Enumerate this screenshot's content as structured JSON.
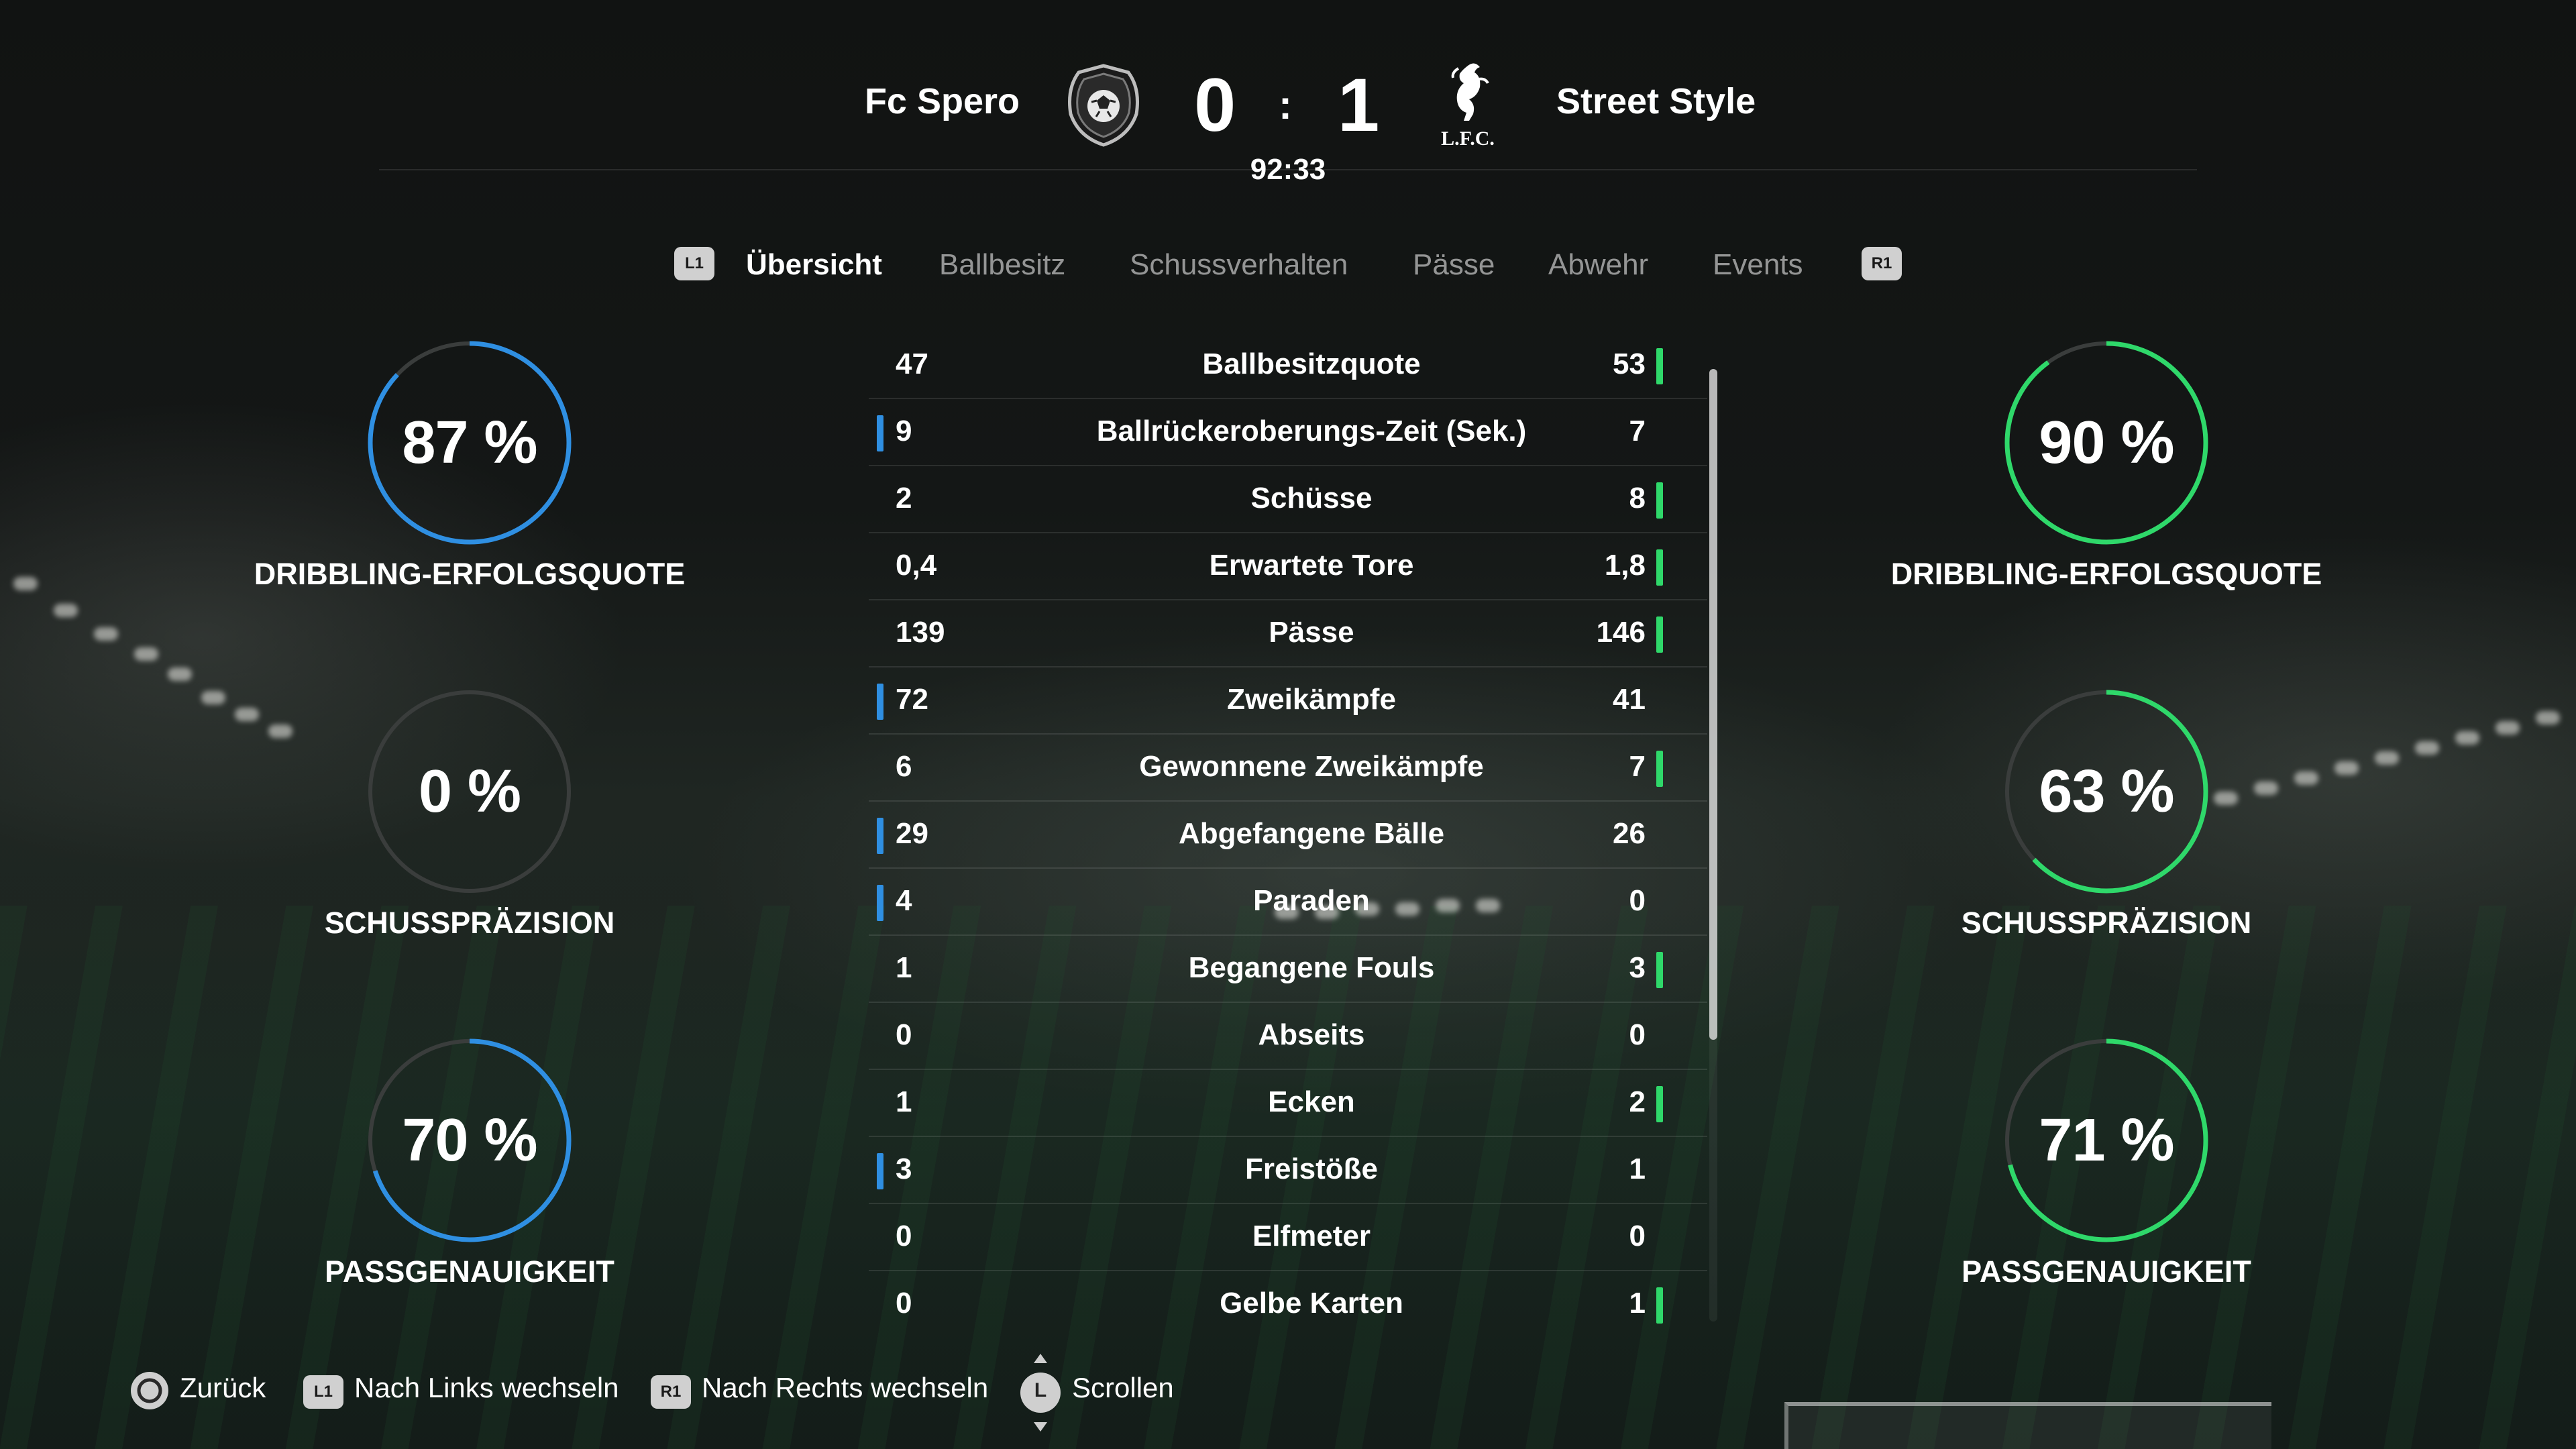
{
  "match": {
    "home_team": "Fc Spero",
    "away_team": "Street Style",
    "home_score": "0",
    "away_score": "1",
    "separator": ":",
    "clock": "92:33",
    "away_crest_text": "L.F.C."
  },
  "tabs": {
    "left_button": "L1",
    "right_button": "R1",
    "items": [
      "Übersicht",
      "Ballbesitz",
      "Schussverhalten",
      "Pässe",
      "Abwehr",
      "Events"
    ],
    "active": "Übersicht"
  },
  "stats": [
    {
      "label": "Ballbesitzquote",
      "home": "47",
      "away": "53",
      "leader": "away"
    },
    {
      "label": "Ballrückeroberungs-Zeit (Sek.)",
      "home": "9",
      "away": "7",
      "leader": "home"
    },
    {
      "label": "Schüsse",
      "home": "2",
      "away": "8",
      "leader": "away"
    },
    {
      "label": "Erwartete Tore",
      "home": "0,4",
      "away": "1,8",
      "leader": "away"
    },
    {
      "label": "Pässe",
      "home": "139",
      "away": "146",
      "leader": "away"
    },
    {
      "label": "Zweikämpfe",
      "home": "72",
      "away": "41",
      "leader": "home"
    },
    {
      "label": "Gewonnene Zweikämpfe",
      "home": "6",
      "away": "7",
      "leader": "away"
    },
    {
      "label": "Abgefangene Bälle",
      "home": "29",
      "away": "26",
      "leader": "home"
    },
    {
      "label": "Paraden",
      "home": "4",
      "away": "0",
      "leader": "home"
    },
    {
      "label": "Begangene Fouls",
      "home": "1",
      "away": "3",
      "leader": "away"
    },
    {
      "label": "Abseits",
      "home": "0",
      "away": "0",
      "leader": "none"
    },
    {
      "label": "Ecken",
      "home": "1",
      "away": "2",
      "leader": "away"
    },
    {
      "label": "Freistöße",
      "home": "3",
      "away": "1",
      "leader": "home"
    },
    {
      "label": "Elfmeter",
      "home": "0",
      "away": "0",
      "leader": "none"
    },
    {
      "label": "Gelbe Karten",
      "home": "0",
      "away": "1",
      "leader": "away"
    }
  ],
  "home_rings": [
    {
      "value_text": "87 %",
      "fraction": 0.87,
      "label": "DRIBBLING-ERFOLGSQUOTE"
    },
    {
      "value_text": "0 %",
      "fraction": 0.0,
      "label": "SCHUSSPRÄZISION"
    },
    {
      "value_text": "70 %",
      "fraction": 0.7,
      "label": "PASSGENAUIGKEIT"
    }
  ],
  "away_rings": [
    {
      "value_text": "90 %",
      "fraction": 0.9,
      "label": "DRIBBLING-ERFOLGSQUOTE"
    },
    {
      "value_text": "63 %",
      "fraction": 0.63,
      "label": "SCHUSSPRÄZISION"
    },
    {
      "value_text": "71 %",
      "fraction": 0.71,
      "label": "PASSGENAUIGKEIT"
    }
  ],
  "footer": {
    "back": "Zurück",
    "left_switch_button": "L1",
    "left_switch": "Nach Links wechseln",
    "right_switch_button": "R1",
    "right_switch": "Nach Rechts wechseln",
    "scroll_button": "L",
    "scroll": "Scrollen"
  },
  "colors": {
    "home_accent": "#2f8fe2",
    "away_accent": "#2fd86a",
    "ring_track": "#3a3d3c"
  },
  "icons": {
    "home_crest": "football-crest-icon",
    "away_crest": "liverbird-crest-icon",
    "back": "circle-button-icon",
    "scroll": "left-stick-icon"
  }
}
